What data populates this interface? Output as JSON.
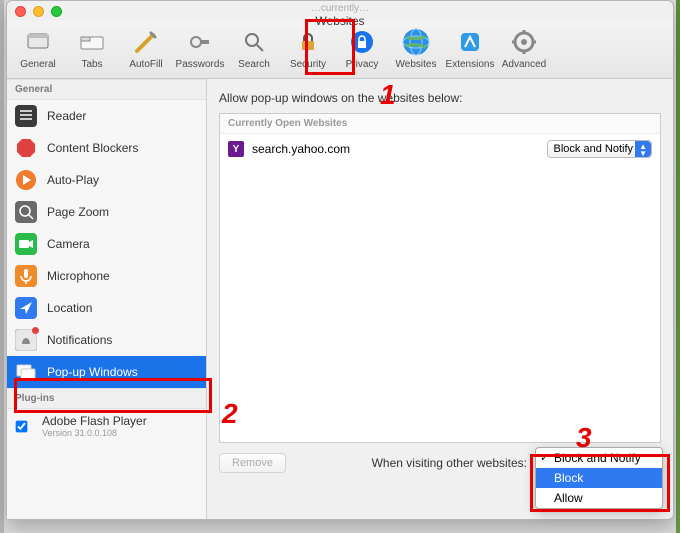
{
  "window": {
    "url_hint": "…currently…",
    "title": "Websites"
  },
  "toolbar": [
    {
      "id": "general",
      "label": "General"
    },
    {
      "id": "tabs",
      "label": "Tabs"
    },
    {
      "id": "autofill",
      "label": "AutoFill"
    },
    {
      "id": "passwords",
      "label": "Passwords"
    },
    {
      "id": "search",
      "label": "Search"
    },
    {
      "id": "security",
      "label": "Security"
    },
    {
      "id": "privacy",
      "label": "Privacy"
    },
    {
      "id": "websites",
      "label": "Websites",
      "selected": true
    },
    {
      "id": "extensions",
      "label": "Extensions"
    },
    {
      "id": "advanced",
      "label": "Advanced"
    }
  ],
  "sidebar": {
    "section_general": "General",
    "items": [
      {
        "id": "reader",
        "label": "Reader"
      },
      {
        "id": "content-blockers",
        "label": "Content Blockers"
      },
      {
        "id": "auto-play",
        "label": "Auto-Play"
      },
      {
        "id": "page-zoom",
        "label": "Page Zoom"
      },
      {
        "id": "camera",
        "label": "Camera"
      },
      {
        "id": "microphone",
        "label": "Microphone"
      },
      {
        "id": "location",
        "label": "Location"
      },
      {
        "id": "notifications",
        "label": "Notifications",
        "badge": true
      },
      {
        "id": "popup-windows",
        "label": "Pop-up Windows",
        "selected": true
      }
    ],
    "section_plugins": "Plug-ins",
    "plugin": {
      "label": "Adobe Flash Player",
      "version": "Version 31.0.0.108",
      "checked": true
    }
  },
  "main": {
    "header": "Allow pop-up windows on the websites below:",
    "list_header": "Currently Open Websites",
    "rows": [
      {
        "icon": "Y",
        "site": "search.yahoo.com",
        "setting": "Block and Notify"
      }
    ],
    "remove": "Remove",
    "footer_label": "When visiting other websites:",
    "dropdown": {
      "options": [
        "Block and Notify",
        "Block",
        "Allow"
      ],
      "checked_index": 0,
      "highlighted_index": 1
    }
  },
  "annotations": {
    "n1": "1",
    "n2": "2",
    "n3": "3"
  }
}
